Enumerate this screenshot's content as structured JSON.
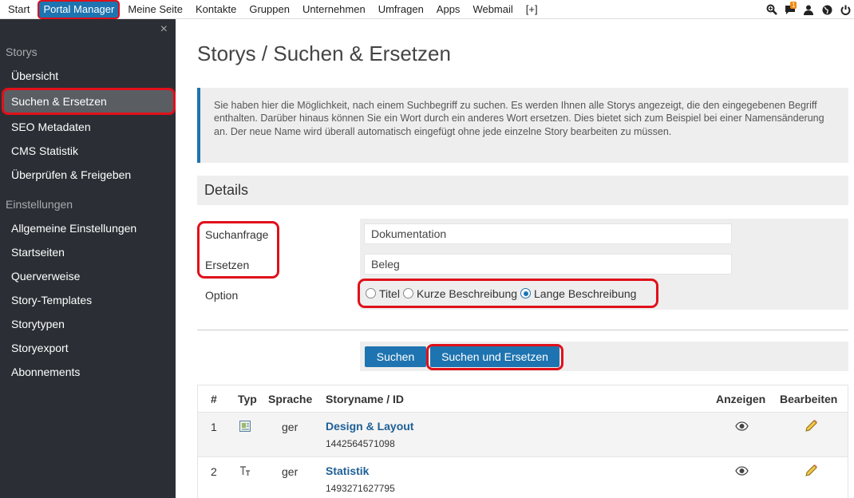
{
  "topnav": {
    "items": [
      "Start",
      "Portal Manager",
      "Meine Seite",
      "Kontakte",
      "Gruppen",
      "Unternehmen",
      "Umfragen",
      "Apps",
      "Webmail",
      "[+]"
    ],
    "notification_count": "1"
  },
  "sidebar": {
    "close": "×",
    "section1": "Storys",
    "items1": [
      "Übersicht",
      "Suchen & Ersetzen",
      "SEO Metadaten",
      "CMS Statistik",
      "Überprüfen & Freigeben"
    ],
    "section2": "Einstellungen",
    "items2": [
      "Allgemeine Einstellungen",
      "Startseiten",
      "Querverweise",
      "Story-Templates",
      "Storytypen",
      "Storyexport",
      "Abonnements"
    ]
  },
  "main": {
    "title": "Storys / Suchen & Ersetzen",
    "info": "Sie haben hier die Möglichkeit, nach einem Suchbegriff zu suchen. Es werden Ihnen alle Storys angezeigt, die den eingegebenen Begriff enthalten. Darüber hinaus können Sie ein Wort durch ein anderes Wort ersetzen. Dies bietet sich zum Beispiel bei einer Namensänderung an. Der neue Name wird überall automatisch eingefügt ohne jede einzelne Story bearbeiten zu müssen.",
    "details": "Details",
    "form": {
      "search_label": "Suchanfrage",
      "search_value": "Dokumentation",
      "replace_label": "Ersetzen",
      "replace_value": "Beleg",
      "option_label": "Option",
      "options": [
        "Titel",
        "Kurze Beschreibung",
        "Lange Beschreibung"
      ],
      "selected_option": "Lange Beschreibung"
    },
    "buttons": {
      "search": "Suchen",
      "search_replace": "Suchen und Ersetzen"
    },
    "table": {
      "headers": [
        "#",
        "Typ",
        "Sprache",
        "Storyname / ID",
        "Anzeigen",
        "Bearbeiten"
      ],
      "rows": [
        {
          "num": "1",
          "lang": "ger",
          "name": "Design & Layout",
          "id": "1442564571098"
        },
        {
          "num": "2",
          "lang": "ger",
          "name": "Statistik",
          "id": "1493271627795"
        }
      ]
    }
  }
}
